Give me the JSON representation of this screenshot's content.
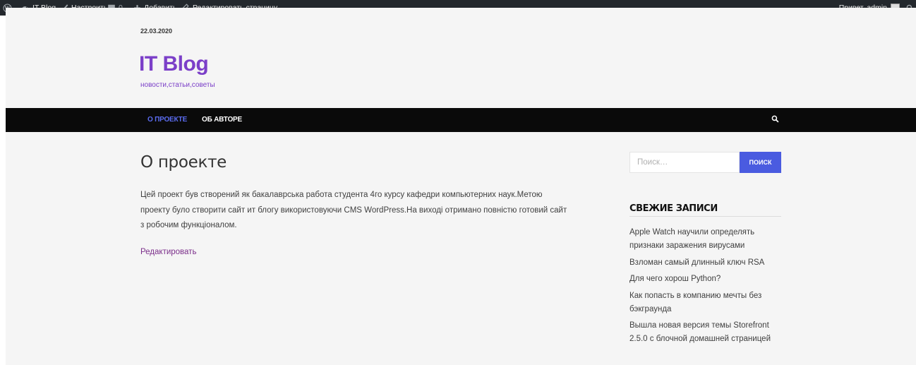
{
  "admin_bar": {
    "site_name": "IT Blog",
    "customize": "Настроить",
    "comments_count": "0",
    "add_new": "Добавить",
    "edit_page": "Редактировать страницу",
    "greeting": "Привет, admin"
  },
  "header": {
    "date": "22.03.2020",
    "site_title": "IT Blog",
    "site_description": "новости,статьи,советы"
  },
  "nav": {
    "items": [
      {
        "label": "О ПРОЕКТЕ",
        "active": true
      },
      {
        "label": "ОБ АВТОРЕ",
        "active": false
      }
    ]
  },
  "main": {
    "title": "О проекте",
    "body": "Цей проект був створений як бакалаврська работа студента 4го курсу кафедри компьютерних наук.Метою проекту було створити сайт ит блогу використовуючи CMS WordPress.На виході отримано повністю готовий сайт з робочим функціоналом.",
    "edit_link": "Редактировать"
  },
  "sidebar": {
    "search_placeholder": "Поиск…",
    "search_button": "ПОИСК",
    "recent_title": "СВЕЖИЕ ЗАПИСИ",
    "recent_posts": [
      "Apple Watch научили определять признаки заражения вирусами",
      "Взломан самый длинный ключ RSA",
      "Для чего хорош Python?",
      "Как попасть в компанию мечты без бэкграунда",
      "Вышла новая версия темы Storefront 2.5.0 с блочной домашней страницей"
    ]
  },
  "colors": {
    "accent_purple": "#7b3fc8",
    "nav_active": "#4a5be0",
    "admin_bar_bg": "#23282d",
    "nav_bg": "#0a0a0a",
    "edit_link": "#7b2e8a"
  },
  "icons": [
    "wordpress-icon",
    "dashboard-icon",
    "brush-icon",
    "comment-icon",
    "plus-icon",
    "pencil-icon",
    "avatar-icon",
    "search-icon"
  ]
}
